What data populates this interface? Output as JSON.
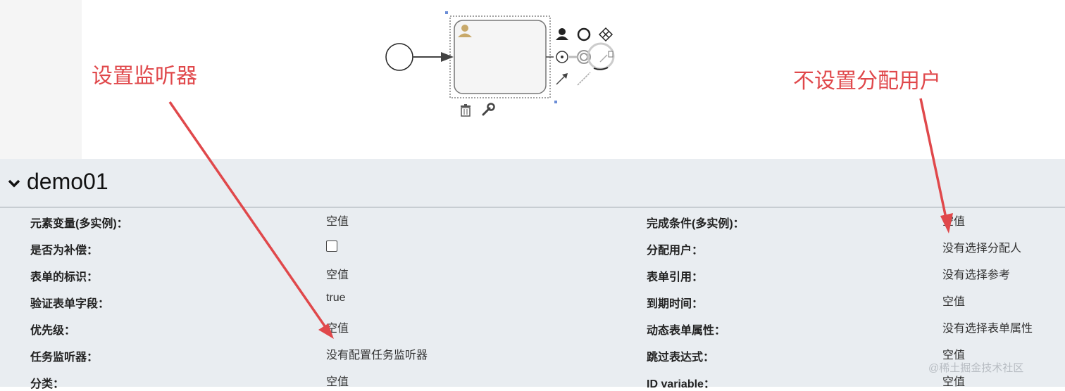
{
  "panel": {
    "title": "demo01",
    "rows": [
      {
        "label": "元素变量(多实例)：",
        "value": "空值"
      },
      {
        "label": "是否为补偿：",
        "value": "",
        "checkbox": true
      },
      {
        "label": "表单的标识：",
        "value": "空值"
      },
      {
        "label": "验证表单字段：",
        "value": "true"
      },
      {
        "label": "优先级：",
        "value": "空值"
      },
      {
        "label": "任务监听器：",
        "value": "没有配置任务监听器"
      },
      {
        "label": "分类：",
        "value": "空值"
      }
    ],
    "rows_right": [
      {
        "label": "完成条件(多实例)：",
        "value": "空值"
      },
      {
        "label": "分配用户：",
        "value": "没有选择分配人"
      },
      {
        "label": "表单引用：",
        "value": "没有选择参考"
      },
      {
        "label": "到期时间：",
        "value": "空值"
      },
      {
        "label": "动态表单属性：",
        "value": "没有选择表单属性"
      },
      {
        "label": "跳过表达式：",
        "value": "空值"
      },
      {
        "label": "ID variable：",
        "value": "空值"
      }
    ]
  },
  "annotations": {
    "left": "设置监听器",
    "right": "不设置分配用户"
  },
  "watermark": "@稀土掘金技术社区",
  "icons": [
    "user-task-icon",
    "palette-user-icon",
    "palette-circle-icon",
    "palette-gateway-icon",
    "palette-event-icon",
    "palette-intermediate-event-icon",
    "palette-arrow-icon",
    "palette-line-icon",
    "trash-icon",
    "wrench-icon",
    "chevron-down-icon"
  ],
  "colors": {
    "annotation": "#e0484b",
    "panel_bg": "#e9edf1",
    "task_fill": "#f5f5f5"
  }
}
